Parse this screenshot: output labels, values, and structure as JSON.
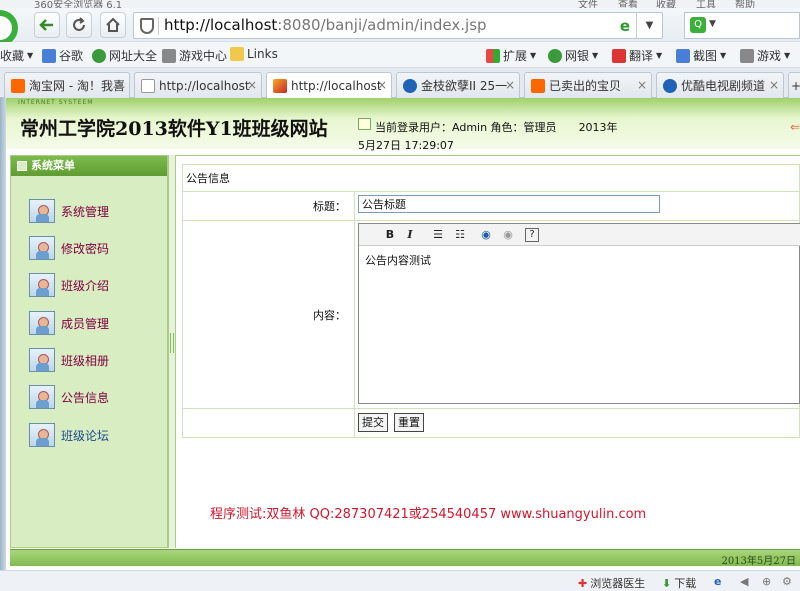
{
  "browser": {
    "title_fragments": [
      "360安全浏览器 6.1",
      "文件",
      "查看",
      "收藏",
      "工具",
      "帮助"
    ],
    "address": {
      "host": "http://localhost",
      "rest": ":8080/banji/admin/index.jsp"
    },
    "bookmarks": [
      "收藏",
      "谷歌",
      "网址大全",
      "游戏中心",
      "Links",
      "扩展",
      "网银",
      "翻译",
      "截图",
      "游戏"
    ],
    "tabs": [
      "淘宝网 - 淘！我喜",
      "http://localhost",
      "http://localhost",
      "金枝欲孽II 25一",
      "已卖出的宝贝",
      "优酷电视剧频道"
    ]
  },
  "site": {
    "tiny": "INTERNET SYSTEEM",
    "title": "常州工学院2013软件Y1班班级网站",
    "user_info": "当前登录用户：Admin  角色：管理员",
    "year": "2013年",
    "datetime": "5月27日  17:29:07"
  },
  "sidebar": {
    "header": "系统菜单",
    "items": [
      "系统管理",
      "修改密码",
      "班级介绍",
      "成员管理",
      "班级相册",
      "公告信息",
      "班级论坛"
    ]
  },
  "form": {
    "section": "公告信息",
    "title_label": "标题：",
    "title_value": "公告标题",
    "content_label": "内容：",
    "content_value": "公告内容测试",
    "submit": "提交",
    "reset": "重置"
  },
  "credit": "程序测试:双鱼林 QQ:287307421或254540457 www.shuangyulin.com",
  "footer_date": "2013年5月27日",
  "statusbar": {
    "doctor": "浏览器医生",
    "download": "下载"
  }
}
